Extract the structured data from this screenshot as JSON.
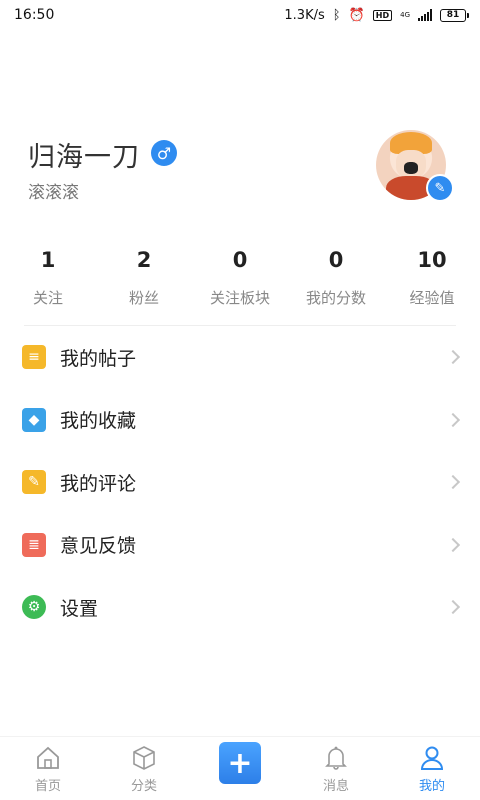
{
  "status_bar": {
    "time": "16:50",
    "network_speed": "1.3K/s",
    "bluetooth_icon": "bluetooth-icon",
    "alarm_icon": "alarm-icon",
    "hd_label": "HD",
    "network_label": "4G",
    "battery": "81"
  },
  "profile": {
    "username": "归海一刀",
    "gender_symbol": "♂",
    "signature": "滚滚滚",
    "edit_icon": "✎"
  },
  "stats": [
    {
      "value": "1",
      "label": "关注"
    },
    {
      "value": "2",
      "label": "粉丝"
    },
    {
      "value": "0",
      "label": "关注板块"
    },
    {
      "value": "0",
      "label": "我的分数"
    },
    {
      "value": "10",
      "label": "经验值"
    }
  ],
  "menu": [
    {
      "label": "我的帖子",
      "icon": "posts-icon",
      "color": "#f5b82a",
      "glyph": "≡"
    },
    {
      "label": "我的收藏",
      "icon": "favorites-cube-icon",
      "color": "#3aa2e8",
      "glyph": "◆"
    },
    {
      "label": "我的评论",
      "icon": "comments-edit-icon",
      "color": "#f5b82a",
      "glyph": "✎"
    },
    {
      "label": "意见反馈",
      "icon": "feedback-clipboard-icon",
      "color": "#ef6b5a",
      "glyph": "≣"
    },
    {
      "label": "设置",
      "icon": "settings-gear-icon",
      "color": "#3dbb55",
      "glyph": "⚙"
    }
  ],
  "tabs": [
    {
      "label": "首页",
      "icon": "home-icon"
    },
    {
      "label": "分类",
      "icon": "category-cube-icon"
    },
    {
      "label": "",
      "icon": "plus-icon",
      "glyph": "+"
    },
    {
      "label": "消息",
      "icon": "bell-icon"
    },
    {
      "label": "我的",
      "icon": "user-icon",
      "active": true
    }
  ],
  "colors": {
    "accent": "#2f8cf0"
  }
}
